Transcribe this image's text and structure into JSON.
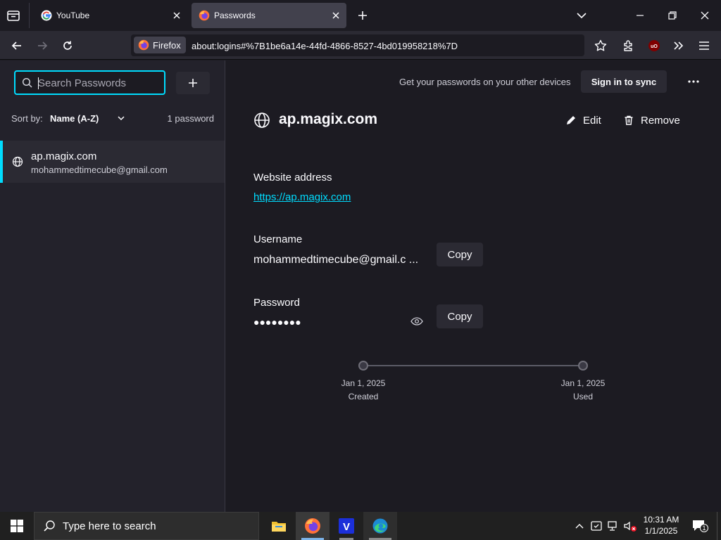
{
  "tabs": [
    {
      "label": "YouTube",
      "active": false
    },
    {
      "label": "Passwords",
      "active": true
    }
  ],
  "navbar": {
    "identity_label": "Firefox",
    "url": "about:logins#%7B1be6a14e-44fd-4866-8527-4bd019958218%7D"
  },
  "sidebar": {
    "search_placeholder": "Search Passwords",
    "sort_label": "Sort by:",
    "sort_value": "Name (A-Z)",
    "count": "1 password",
    "items": [
      {
        "title": "ap.magix.com",
        "username": "mohammedtimecube@gmail.com"
      }
    ]
  },
  "main": {
    "sync_text": "Get your passwords on your other devices",
    "sync_button": "Sign in to sync",
    "more_label": "···",
    "title": "ap.magix.com",
    "edit_label": "Edit",
    "remove_label": "Remove",
    "website_label": "Website address",
    "website_value": "https://ap.magix.com",
    "username_label": "Username",
    "username_value": "mohammedtimecube@gmail.c ...",
    "password_label": "Password",
    "password_value": "●●●●●●●●",
    "copy_label": "Copy",
    "timeline": {
      "created_date": "Jan 1, 2025",
      "created_label": "Created",
      "used_date": "Jan 1, 2025",
      "used_label": "Used"
    }
  },
  "taskbar": {
    "search_placeholder": "Type here to search",
    "time": "10:31 AM",
    "date": "1/1/2025",
    "notification_count": "1"
  },
  "colors": {
    "accent": "#00ddff",
    "link": "#00ddff",
    "firefox_orange": "#ff7139"
  }
}
